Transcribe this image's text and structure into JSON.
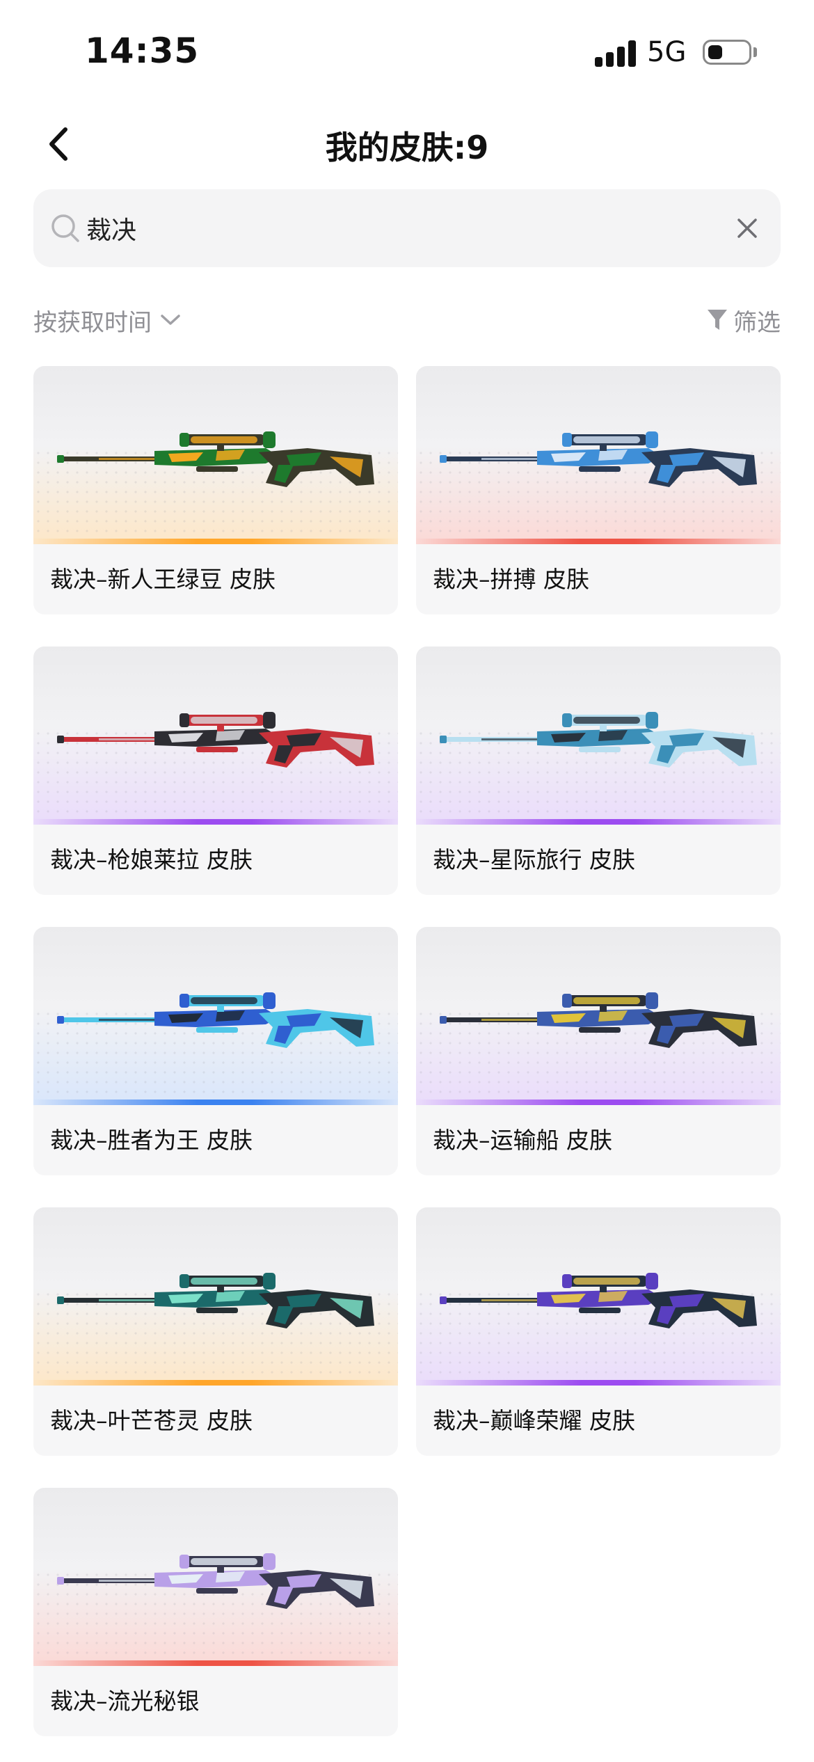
{
  "status": {
    "time": "14:35",
    "network": "5G"
  },
  "header": {
    "title": "我的皮肤:9",
    "back_icon": "chevron-left-icon"
  },
  "search": {
    "value": "裁决",
    "placeholder": "",
    "icon": "search-icon",
    "clear_icon": "close-icon"
  },
  "toolbar": {
    "sort_label": "按获取时间",
    "sort_icon": "chevron-down-icon",
    "filter_label": "筛选",
    "filter_icon": "funnel-icon"
  },
  "rarity_colors": {
    "legendary": {
      "bar": "#ffa62b",
      "tint": "#fde7c8"
    },
    "mythic": {
      "bar": "#ee5446",
      "tint": "#fbd9d6"
    },
    "epic": {
      "bar": "#9c4cf0",
      "tint": "#eadcfb"
    },
    "rare": {
      "bar": "#3b82f0",
      "tint": "#d9e6fb"
    }
  },
  "skins": [
    {
      "label": "裁决–新人王绿豆 皮肤",
      "rarity": "legendary",
      "palette": [
        "#1e7a2d",
        "#f2a81f",
        "#3a3a2a"
      ]
    },
    {
      "label": "裁决–拼搏 皮肤",
      "rarity": "mythic",
      "palette": [
        "#3f8fd8",
        "#d7e6f7",
        "#2a3b55"
      ]
    },
    {
      "label": "裁决–枪娘莱拉 皮肤",
      "rarity": "epic",
      "palette": [
        "#2d2d33",
        "#d9d9de",
        "#c8323a"
      ]
    },
    {
      "label": "裁决–星际旅行 皮肤",
      "rarity": "epic",
      "palette": [
        "#3b8fb8",
        "#28323d",
        "#b8dff0"
      ]
    },
    {
      "label": "裁决–胜者为王 皮肤",
      "rarity": "rare",
      "palette": [
        "#2f5fd0",
        "#1f2a3a",
        "#4fc6e8"
      ]
    },
    {
      "label": "裁决–运输船 皮肤",
      "rarity": "epic",
      "palette": [
        "#3b5cae",
        "#e0c33a",
        "#2a2f3a"
      ]
    },
    {
      "label": "裁决–叶芒苍灵 皮肤",
      "rarity": "legendary",
      "palette": [
        "#1b6a6a",
        "#7be0c8",
        "#262f33"
      ]
    },
    {
      "label": "裁决–巅峰荣耀 皮肤",
      "rarity": "epic",
      "palette": [
        "#5a3fc0",
        "#e0c050",
        "#233040"
      ]
    },
    {
      "label": "裁决–流光秘银",
      "rarity": "mythic",
      "palette": [
        "#b9a0e8",
        "#e6eef6",
        "#3a3a50"
      ]
    }
  ]
}
